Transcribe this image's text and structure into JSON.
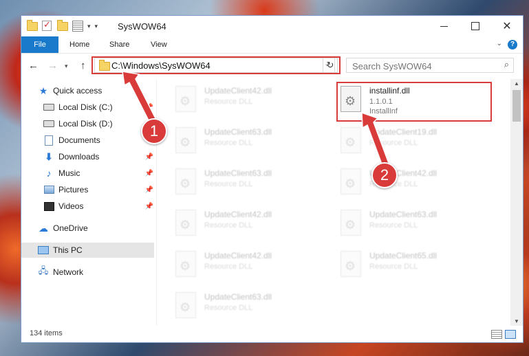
{
  "window": {
    "title": "SysWOW64",
    "qat_icons": [
      "folder-icon",
      "properties-check-icon",
      "new-folder-icon",
      "customize-icon"
    ],
    "controls": {
      "minimize": "minimize",
      "maximize": "maximize",
      "close": "✕"
    }
  },
  "ribbon": {
    "tabs": [
      {
        "label": "File",
        "active": true
      },
      {
        "label": "Home"
      },
      {
        "label": "Share"
      },
      {
        "label": "View"
      }
    ],
    "help": "?"
  },
  "navigation": {
    "back": "←",
    "forward": "→",
    "recent": "▾",
    "up": "↑",
    "address": "C:\\Windows\\SysWOW64",
    "refresh": "↻",
    "search_placeholder": "Search SysWOW64"
  },
  "sidebar": {
    "items": [
      {
        "label": "Quick access",
        "icon": "star-icon"
      },
      {
        "label": "Local Disk (C:)",
        "icon": "drive-icon",
        "pinned": true
      },
      {
        "label": "Local Disk (D:)",
        "icon": "drive-icon"
      },
      {
        "label": "Documents",
        "icon": "documents-icon"
      },
      {
        "label": "Downloads",
        "icon": "downloads-icon",
        "pinned": true
      },
      {
        "label": "Music",
        "icon": "music-icon",
        "pinned": true
      },
      {
        "label": "Pictures",
        "icon": "pictures-icon",
        "pinned": true
      },
      {
        "label": "Videos",
        "icon": "videos-icon",
        "pinned": true
      },
      {
        "label": "OneDrive",
        "icon": "cloud-icon"
      },
      {
        "label": "This PC",
        "icon": "computer-icon",
        "selected": true
      },
      {
        "label": "Network",
        "icon": "network-icon"
      }
    ]
  },
  "files": {
    "highlighted": {
      "name": "installinf.dll",
      "version": "1.1.0.1",
      "description": "InstallInf"
    },
    "left_column": [
      {
        "name": "UpdateClient42.dll",
        "type": "Resource DLL"
      },
      {
        "name": "UpdateClient63.dll",
        "type": "Resource DLL"
      },
      {
        "name": "UpdateClient63.dll",
        "type": "Resource DLL"
      },
      {
        "name": "UpdateClient42.dll",
        "type": "Resource DLL"
      },
      {
        "name": "UpdateClient42.dll",
        "type": "Resource DLL"
      },
      {
        "name": "UpdateClient63.dll",
        "type": "Resource DLL"
      }
    ],
    "right_column": [
      {
        "name": "UpdateClient19.dll",
        "type": "Resource DLL"
      },
      {
        "name": "UpdateClient42.dll",
        "type": "Resource DLL"
      },
      {
        "name": "UpdateClient63.dll",
        "type": "Resource DLL"
      },
      {
        "name": "UpdateClient65.dll",
        "type": "Resource DLL"
      }
    ]
  },
  "status": {
    "items_count": "134 items"
  },
  "annotations": {
    "step1": "1",
    "step2": "2",
    "accent": "#d93a3a"
  }
}
